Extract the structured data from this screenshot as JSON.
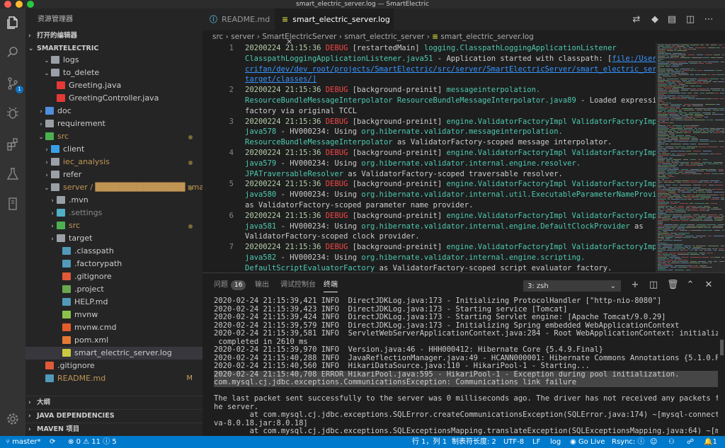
{
  "window": {
    "title": "smart_electric_server.log — SmartElectric"
  },
  "sidebar": {
    "title": "资源管理器",
    "open_editors": "打开的编辑器",
    "project": "SMARTELECTRIC",
    "tree": [
      {
        "label": "logs",
        "depth": 2,
        "type": "folder",
        "open": true
      },
      {
        "label": "to_delete",
        "depth": 2,
        "type": "folder",
        "open": true
      },
      {
        "label": "Greeting.java",
        "depth": 3,
        "type": "java"
      },
      {
        "label": "GreetingController.java",
        "depth": 3,
        "type": "java"
      },
      {
        "label": "doc",
        "depth": 1,
        "type": "folder-doc",
        "open": false
      },
      {
        "label": "requirement",
        "depth": 1,
        "type": "folder",
        "open": false
      },
      {
        "label": "src",
        "depth": 1,
        "type": "folder-src",
        "open": true,
        "dot": true,
        "color": "#c09553"
      },
      {
        "label": "client",
        "depth": 2,
        "type": "folder-client",
        "open": false
      },
      {
        "label": "iec_analysis",
        "depth": 2,
        "type": "folder",
        "open": false,
        "dot": true,
        "color": "#c09553"
      },
      {
        "label": "refer",
        "depth": 2,
        "type": "folder",
        "open": false
      },
      {
        "label": "server / ███████████████ sma...",
        "depth": 2,
        "type": "folder",
        "open": true,
        "dot": true,
        "color": "#c09553"
      },
      {
        "label": ".mvn",
        "depth": 3,
        "type": "folder",
        "open": false
      },
      {
        "label": ".settings",
        "depth": 3,
        "type": "folder-settings",
        "open": false,
        "color": "#8a8a8a"
      },
      {
        "label": "src",
        "depth": 3,
        "type": "folder-src",
        "open": false,
        "dot": true,
        "color": "#c09553"
      },
      {
        "label": "target",
        "depth": 3,
        "type": "folder",
        "open": false
      },
      {
        "label": ".classpath",
        "depth": 4,
        "type": "file-blue"
      },
      {
        "label": ".factorypath",
        "depth": 4,
        "type": "file-blue"
      },
      {
        "label": ".gitignore",
        "depth": 4,
        "type": "file-git"
      },
      {
        "label": ".project",
        "depth": 4,
        "type": "file-green"
      },
      {
        "label": "HELP.md",
        "depth": 4,
        "type": "file-md"
      },
      {
        "label": "mvnw",
        "depth": 4,
        "type": "file-sh"
      },
      {
        "label": "mvnw.cmd",
        "depth": 4,
        "type": "file-cmd"
      },
      {
        "label": "pom.xml",
        "depth": 4,
        "type": "file-xml"
      },
      {
        "label": "smart_electric_server.log",
        "depth": 4,
        "type": "file-log",
        "selected": true
      },
      {
        "label": ".gitignore",
        "depth": 1,
        "type": "file-git"
      },
      {
        "label": "README.md",
        "depth": 1,
        "type": "file-info",
        "mod": "M",
        "color": "#c09553"
      }
    ],
    "bottom_sections": [
      "大纲",
      "JAVA DEPENDENCIES",
      "MAVEN 项目"
    ]
  },
  "editor": {
    "tabs": [
      {
        "label": "README.md",
        "icon": "ⓘ",
        "active": false
      },
      {
        "label": "smart_electric_server.log",
        "icon": "≡",
        "active": true,
        "close": "×"
      }
    ],
    "breadcrumb": [
      "src",
      "server",
      "SmartElectricServer",
      "smart_electric_server",
      "smart_electric_server.log"
    ],
    "lines": [
      {
        "num": "1",
        "segs": [
          [
            "20200224 21:15:36 ",
            "#b5cea8"
          ],
          [
            "DEBUG ",
            "#f44747"
          ],
          [
            "[restartedMain] ",
            "#cccccc"
          ],
          [
            "logging.ClasspathLoggingApplicationListener",
            "#4ec9b0"
          ]
        ]
      },
      {
        "num": "",
        "segs": [
          [
            "ClasspathLoggingApplicationListener.java51",
            "#4ec9b0"
          ],
          [
            " - Application started with classpath: [",
            "#cccccc"
          ],
          [
            "file:/Users/",
            "#3794ff"
          ]
        ]
      },
      {
        "num": "",
        "segs": [
          [
            "crifan/dev/dev_root/projects/SmartElectric/src/server/SmartElectricServer/smart_electric_server/",
            "#3794ff"
          ]
        ]
      },
      {
        "num": "",
        "segs": [
          [
            "target/classes/]",
            "#3794ff"
          ]
        ]
      },
      {
        "num": "2",
        "segs": [
          [
            "20200224 21:15:36 ",
            "#b5cea8"
          ],
          [
            "DEBUG ",
            "#f44747"
          ],
          [
            "[background-preinit] ",
            "#cccccc"
          ],
          [
            "messageinterpolation.",
            "#4ec9b0"
          ]
        ]
      },
      {
        "num": "",
        "segs": [
          [
            "ResourceBundleMessageInterpolator ResourceBundleMessageInterpolator.java89",
            "#4ec9b0"
          ],
          [
            " - Loaded expression",
            "#cccccc"
          ]
        ]
      },
      {
        "num": "",
        "segs": [
          [
            "factory via original TCCL",
            "#cccccc"
          ]
        ]
      },
      {
        "num": "3",
        "segs": [
          [
            "20200224 21:15:36 ",
            "#b5cea8"
          ],
          [
            "DEBUG ",
            "#f44747"
          ],
          [
            "[background-preinit] ",
            "#cccccc"
          ],
          [
            "engine.ValidatorFactoryImpl ValidatorFactoryImpl.",
            "#4ec9b0"
          ]
        ]
      },
      {
        "num": "",
        "segs": [
          [
            "java578",
            "#4ec9b0"
          ],
          [
            " - HV000234: Using ",
            "#cccccc"
          ],
          [
            "org.hibernate.validator.messageinterpolation.",
            "#4ec9b0"
          ]
        ]
      },
      {
        "num": "",
        "segs": [
          [
            "ResourceBundleMessageInterpolator",
            "#4ec9b0"
          ],
          [
            " as ValidatorFactory-scoped message interpolator.",
            "#cccccc"
          ]
        ]
      },
      {
        "num": "4",
        "segs": [
          [
            "20200224 21:15:36 ",
            "#b5cea8"
          ],
          [
            "DEBUG ",
            "#f44747"
          ],
          [
            "[background-preinit] ",
            "#cccccc"
          ],
          [
            "engine.ValidatorFactoryImpl ValidatorFactoryImpl.",
            "#4ec9b0"
          ]
        ]
      },
      {
        "num": "",
        "segs": [
          [
            "java579",
            "#4ec9b0"
          ],
          [
            " - HV000234: Using ",
            "#cccccc"
          ],
          [
            "org.hibernate.validator.internal.engine.resolver.",
            "#4ec9b0"
          ]
        ]
      },
      {
        "num": "",
        "segs": [
          [
            "JPATraversableResolver",
            "#4ec9b0"
          ],
          [
            " as ValidatorFactory-scoped traversable resolver.",
            "#cccccc"
          ]
        ]
      },
      {
        "num": "5",
        "segs": [
          [
            "20200224 21:15:36 ",
            "#b5cea8"
          ],
          [
            "DEBUG ",
            "#f44747"
          ],
          [
            "[background-preinit] ",
            "#cccccc"
          ],
          [
            "engine.ValidatorFactoryImpl ValidatorFactoryImpl.",
            "#4ec9b0"
          ]
        ]
      },
      {
        "num": "",
        "segs": [
          [
            "java580",
            "#4ec9b0"
          ],
          [
            " - HV000234: Using ",
            "#cccccc"
          ],
          [
            "org.hibernate.validator.internal.util.ExecutableParameterNameProvider",
            "#4ec9b0"
          ]
        ]
      },
      {
        "num": "",
        "segs": [
          [
            "as ValidatorFactory-scoped parameter name provider.",
            "#cccccc"
          ]
        ]
      },
      {
        "num": "6",
        "segs": [
          [
            "20200224 21:15:36 ",
            "#b5cea8"
          ],
          [
            "DEBUG ",
            "#f44747"
          ],
          [
            "[background-preinit] ",
            "#cccccc"
          ],
          [
            "engine.ValidatorFactoryImpl ValidatorFactoryImpl.",
            "#4ec9b0"
          ]
        ]
      },
      {
        "num": "",
        "segs": [
          [
            "java581",
            "#4ec9b0"
          ],
          [
            " - HV000234: Using ",
            "#cccccc"
          ],
          [
            "org.hibernate.validator.internal.engine.DefaultClockProvider",
            "#4ec9b0"
          ],
          [
            " as",
            "#cccccc"
          ]
        ]
      },
      {
        "num": "",
        "segs": [
          [
            "ValidatorFactory-scoped clock provider.",
            "#cccccc"
          ]
        ]
      },
      {
        "num": "7",
        "segs": [
          [
            "20200224 21:15:36 ",
            "#b5cea8"
          ],
          [
            "DEBUG ",
            "#f44747"
          ],
          [
            "[background-preinit] ",
            "#cccccc"
          ],
          [
            "engine.ValidatorFactoryImpl ValidatorFactoryImpl.",
            "#4ec9b0"
          ]
        ]
      },
      {
        "num": "",
        "segs": [
          [
            "java582",
            "#4ec9b0"
          ],
          [
            " - HV000234: Using ",
            "#cccccc"
          ],
          [
            "org.hibernate.validator.internal.engine.scripting.",
            "#4ec9b0"
          ]
        ]
      },
      {
        "num": "",
        "segs": [
          [
            "DefaultScriptEvaluatorFactory",
            "#4ec9b0"
          ],
          [
            " as ValidatorFactory-scoped script evaluator factory.",
            "#cccccc"
          ]
        ]
      }
    ]
  },
  "panel": {
    "tabs": [
      {
        "label": "问题",
        "count": "16"
      },
      {
        "label": "输出"
      },
      {
        "label": "调试控制台"
      },
      {
        "label": "终端",
        "active": true
      }
    ],
    "terminal_select": "3: zsh",
    "lines": [
      {
        "text": "2020-02-24 21:15:39,421 INFO  DirectJDKLog.java:173 - Initializing ProtocolHandler [\"http-nio-8080\"]"
      },
      {
        "text": "2020-02-24 21:15:39,423 INFO  DirectJDKLog.java:173 - Starting service [Tomcat]"
      },
      {
        "text": "2020-02-24 21:15:39,424 INFO  DirectJDKLog.java:173 - Starting Servlet engine: [Apache Tomcat/9.0.29]"
      },
      {
        "text": "2020-02-24 21:15:39,579 INFO  DirectJDKLog.java:173 - Initializing Spring embedded WebApplicationContext"
      },
      {
        "text": "2020-02-24 21:15:39,581 INFO  ServletWebServerApplicationContext.java:284 - Root WebApplicationContext: initialization"
      },
      {
        "text": " completed in 2610 ms"
      },
      {
        "text": "2020-02-24 21:15:39,970 INFO  Version.java:46 - HHH000412: Hibernate Core {5.4.9.Final}"
      },
      {
        "text": "2020-02-24 21:15:40,288 INFO  JavaReflectionManager.java:49 - HCANN000001: Hibernate Commons Annotations {5.1.0.Final}"
      },
      {
        "text": "2020-02-24 21:15:40,560 INFO  HikariDataSource.java:110 - HikariPool-1 - Starting..."
      },
      {
        "text": "2020-02-24 21:15:40,708 ERROR HikariPool.java:595 - HikariPool-1 - Exception during pool initialization.",
        "hl": true
      },
      {
        "text": "com.mysql.cj.jdbc.exceptions.CommunicationsException: Communications link failure",
        "hl": true
      },
      {
        "text": ""
      },
      {
        "text": "The last packet sent successfully to the server was 0 milliseconds ago. The driver has not received any packets from t"
      },
      {
        "text": "he server."
      },
      {
        "text": "        at com.mysql.cj.jdbc.exceptions.SQLError.createCommunicationsException(SQLError.java:174) ~[mysql-connector-ja"
      },
      {
        "text": "va-8.0.18.jar:8.0.18]"
      },
      {
        "text": "        at com.mysql.cj.jdbc.exceptions.SQLExceptionsMapping.translateException(SQLExceptionsMapping.java:64) ~[mysql-"
      }
    ]
  },
  "statusbar": {
    "branch": "master*",
    "errors": "0",
    "warnings": "11",
    "infos": "5",
    "position": "行 1，列 1",
    "tab_size": "制表符长度: 2",
    "encoding": "UTF-8",
    "eol": "LF",
    "language": "log",
    "golive": "Go Live",
    "rsync": "Rsync:",
    "notifications": "1"
  }
}
